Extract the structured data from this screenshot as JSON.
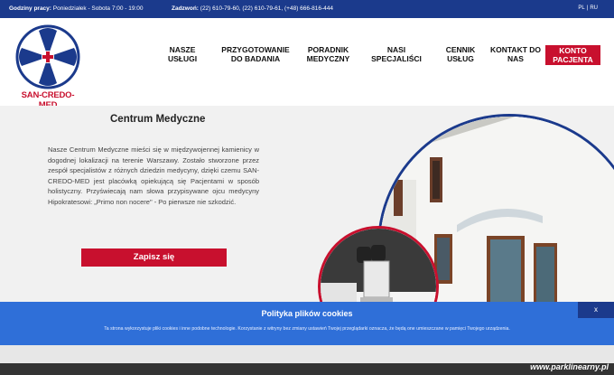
{
  "topbar": {
    "hours_label": "Godziny pracy:",
    "hours_value": "Poniedziałek - Sobota 7:00 - 19:00",
    "phones_label": "Zadzwoń:",
    "phones_value": "(22) 610-79-60, (22) 610-79-61, (+48) 666-816-444",
    "lang": [
      "PL",
      "RU"
    ]
  },
  "logo": {
    "text": "SAN-CREDO-MED"
  },
  "nav": {
    "items": [
      {
        "line1": "NASZE",
        "line2": "USŁUGI"
      },
      {
        "line1": "PRZYGOTOWANIE",
        "line2": "DO BADANIA"
      },
      {
        "line1": "PORADNIK",
        "line2": "MEDYCZNY"
      },
      {
        "line1": "NASI",
        "line2": "SPECJALIŚCI"
      },
      {
        "line1": "CENNIK",
        "line2": "USŁUG"
      },
      {
        "line1": "KONTAKT DO",
        "line2": "NAS"
      }
    ],
    "account": {
      "line1": "KONTO",
      "line2": "PACJENTA"
    }
  },
  "main": {
    "title": "Centrum Medyczne",
    "paragraph": "Nasze Centrum Medyczne mieści się w międzywojennej kamienicy w dogodnej lokalizacji na terenie Warszawy. Zostało stworzone przez zespół specjalistów z różnych dziedzin medycyny, dzięki czemu SAN-CREDO-MED jest placówką opiekującą się Pacjentami w sposób holistyczny. Przyświecają nam słowa przypisywane ojcu medycyny Hipokratesowi: „Primo non nocere\" - Po pierwsze nie szkodzić.",
    "cta": "Zapisz się"
  },
  "cookie": {
    "title": "Polityka plików cookies",
    "text": "Ta strona wykorzystuje pliki cookies i inne podobne technologie. Korzystanie z witryny bez zmiany ustawień Twojej przeglądarki oznacza, że będą one umieszczane w pamięci Twojego urządzenia.",
    "close": "x"
  },
  "watermark": "www.parklinearny.pl",
  "colors": {
    "navy": "#1b3a8c",
    "red": "#c8102e",
    "cookie_blue": "#2f6fd8"
  }
}
